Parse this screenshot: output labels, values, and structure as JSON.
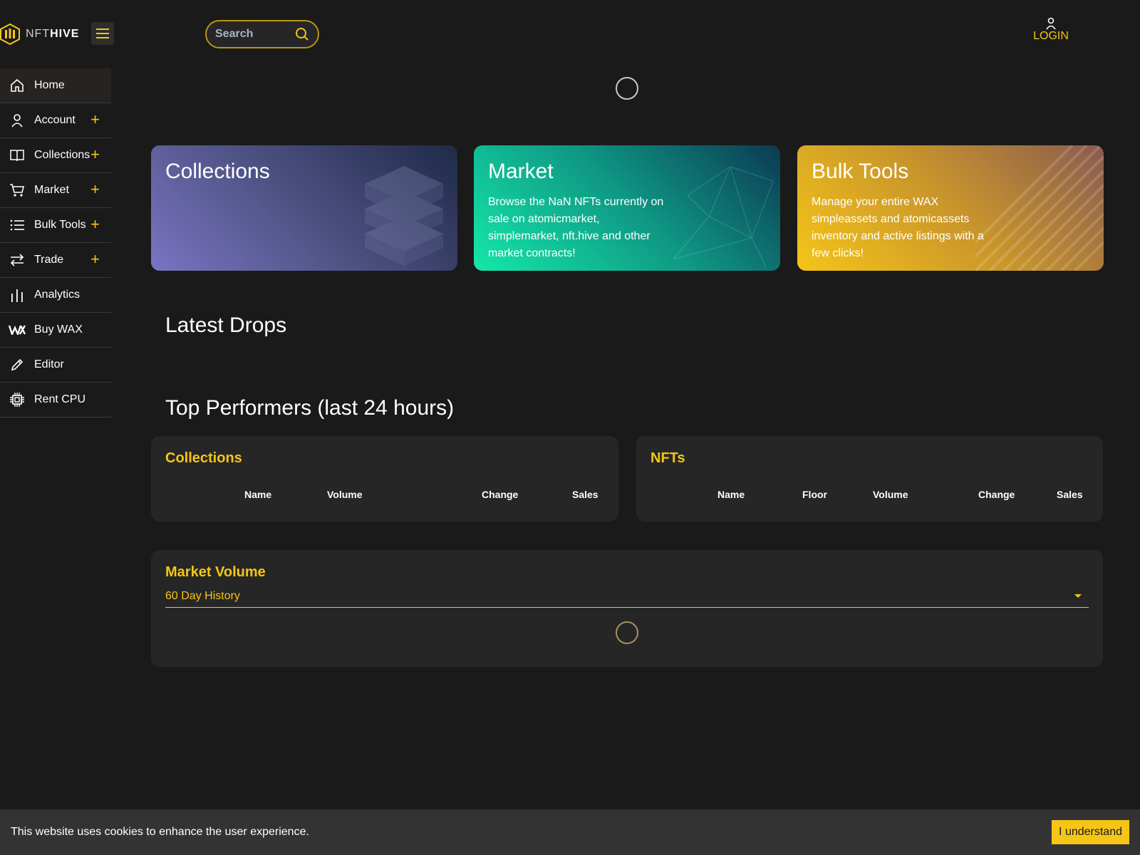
{
  "header": {
    "logo_text_light": "NFT",
    "logo_text_bold": "HIVE",
    "search_placeholder": "Search",
    "login_label": "LOGIN"
  },
  "sidebar": {
    "items": [
      {
        "label": "Home",
        "icon": "home-icon",
        "expandable": false
      },
      {
        "label": "Account",
        "icon": "user-icon",
        "expandable": true
      },
      {
        "label": "Collections",
        "icon": "book-icon",
        "expandable": true
      },
      {
        "label": "Market",
        "icon": "cart-icon",
        "expandable": true
      },
      {
        "label": "Bulk Tools",
        "icon": "list-icon",
        "expandable": true
      },
      {
        "label": "Trade",
        "icon": "swap-icon",
        "expandable": true
      },
      {
        "label": "Analytics",
        "icon": "bar-chart-icon",
        "expandable": false
      },
      {
        "label": "Buy WAX",
        "icon": "wax-icon",
        "expandable": false
      },
      {
        "label": "Editor",
        "icon": "pencil-icon",
        "expandable": false
      },
      {
        "label": "Rent CPU",
        "icon": "cpu-icon",
        "expandable": false
      }
    ],
    "plus_symbol": "+"
  },
  "cards": {
    "collections": {
      "title": "Collections",
      "text": ""
    },
    "market": {
      "title": "Market",
      "text": "Browse the NaN NFTs currently on sale on atomicmarket, simplemarket, nft.hive and other market contracts!"
    },
    "bulk": {
      "title": "Bulk Tools",
      "text": "Manage your entire WAX simpleassets and atomicassets inventory and active listings with a few clicks!"
    }
  },
  "latest_drops": {
    "title": "Latest Drops"
  },
  "top_performers": {
    "title": "Top Performers (last 24 hours)",
    "collections": {
      "title": "Collections",
      "columns": [
        "Name",
        "Volume",
        "Change",
        "Sales"
      ]
    },
    "nfts": {
      "title": "NFTs",
      "columns": [
        "Name",
        "Floor",
        "Volume",
        "Change",
        "Sales"
      ]
    }
  },
  "market_volume": {
    "title": "Market Volume",
    "selected_range": "60 Day History"
  },
  "cookie": {
    "text": "This website uses cookies to enhance the user experience.",
    "button": "I understand"
  },
  "colors": {
    "accent": "#f5c518",
    "background": "#1a1a1a",
    "panel": "#262626"
  }
}
